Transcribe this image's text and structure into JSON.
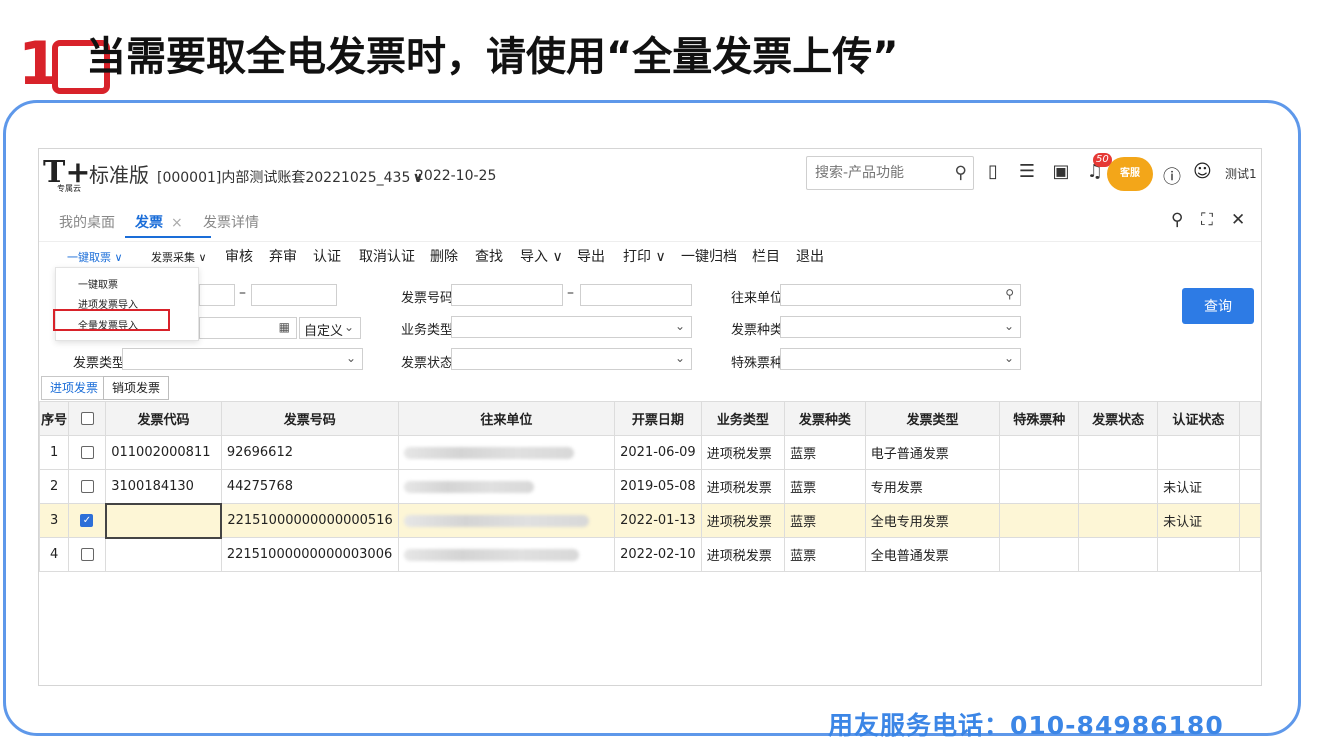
{
  "slide": {
    "step_number": "1",
    "headline": "当需要取全电发票时，请使用“全量发票上传”",
    "phone": "用友服务电话：010-84986180"
  },
  "app": {
    "logo": "T+",
    "logo_sub": "专属云",
    "edition": "标准版",
    "account": "[000001]内部测试账套20221025_435",
    "account_chevron": "∨",
    "date": "2022-10-25",
    "search_placeholder": "搜索-产品功能",
    "notification_count": "50",
    "mascot_label": "客服",
    "user": "测试1"
  },
  "tabs": [
    {
      "label": "我的桌面"
    },
    {
      "label": "发票",
      "active": true,
      "close": "×"
    },
    {
      "label": "发票详情"
    }
  ],
  "toolbar": {
    "items": [
      "一键取票 ∨",
      "发票采集 ∨",
      "审核",
      "弃审",
      "认证",
      "取消认证",
      "删除",
      "查找",
      "导入 ∨",
      "导出",
      "打印 ∨",
      "一键归档",
      "栏目",
      "退出"
    ]
  },
  "dropdown": {
    "items": [
      "一键取票",
      "进项发票导入",
      "全量发票导入"
    ]
  },
  "filters": {
    "invoice_no_label": "发票号码",
    "counterparty_label": "往来单位",
    "business_type_label": "业务类型",
    "invoice_kind_label": "发票种类",
    "invoice_status_label": "发票状态",
    "special_label": "特殊票种",
    "invoice_type_label": "发票类型",
    "custom_label": "自定义",
    "range_sep": "–",
    "query_button": "查询"
  },
  "subtabs": [
    "进项发票",
    "销项发票"
  ],
  "table": {
    "headers": [
      "序号",
      "",
      "发票代码",
      "发票号码",
      "往来单位",
      "开票日期",
      "业务类型",
      "发票种类",
      "发票类型",
      "特殊票种",
      "发票状态",
      "认证状态"
    ],
    "rows": [
      {
        "no": "1",
        "checked": false,
        "code": "011002000811",
        "number": "92696612",
        "date": "2021-06-09",
        "biz": "进项税发票",
        "kind": "蓝票",
        "type": "电子普通发票",
        "special": "",
        "status": "",
        "cert": ""
      },
      {
        "no": "2",
        "checked": false,
        "code": "3100184130",
        "number": "44275768",
        "date": "2019-05-08",
        "biz": "进项税发票",
        "kind": "蓝票",
        "type": "专用发票",
        "special": "",
        "status": "",
        "cert": "未认证"
      },
      {
        "no": "3",
        "checked": true,
        "code": "",
        "number": "22151000000000000516",
        "date": "2022-01-13",
        "biz": "进项税发票",
        "kind": "蓝票",
        "type": "全电专用发票",
        "special": "",
        "status": "",
        "cert": "未认证"
      },
      {
        "no": "4",
        "checked": false,
        "code": "",
        "number": "22151000000000003006",
        "date": "2022-02-10",
        "biz": "进项税发票",
        "kind": "蓝票",
        "type": "全电普通发票",
        "special": "",
        "status": "",
        "cert": ""
      }
    ]
  }
}
